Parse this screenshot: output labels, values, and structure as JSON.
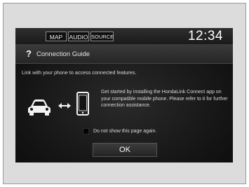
{
  "topbar": {
    "buttons": [
      "MAP",
      "AUDIO",
      "SOURCE"
    ],
    "clock": "12:34"
  },
  "dialog": {
    "title": "Connection Guide",
    "intro": "Link with your phone to access connected features.",
    "description": "Get started by installing the HondaLink Connect app on your compatible mobile phone. Please refer to it for further connection assistance.",
    "checkbox_label": "Do not show this page again.",
    "ok_label": "OK"
  },
  "icons": {
    "help": "question-mark-icon",
    "car": "car-icon",
    "arrow": "double-arrow-icon",
    "phone": "phone-icon"
  },
  "colors": {
    "screen_background": "#141414",
    "text": "#d8d8d8",
    "frame": "#dcdcdc"
  }
}
